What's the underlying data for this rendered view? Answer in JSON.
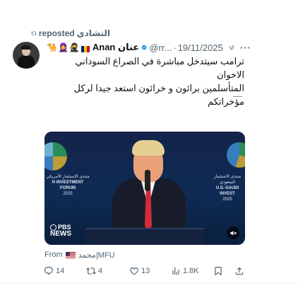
{
  "repost": {
    "user": "التشادي",
    "label": "reposted"
  },
  "author": {
    "display_name": "Anan عنان",
    "handle": "@rr...",
    "separator": "·",
    "date": "19/11/2025",
    "more": "···"
  },
  "tweet": {
    "line1": "ترامب سيتدخل مباشرة في الصراع السوداني الاخوان",
    "line2": "المتأسلمين برائون و خرائون استعد جيدا لركل مؤخراتكم",
    "line3": "__"
  },
  "media": {
    "forum_left_ar": "منتدى الاستثمار الأمريكي",
    "forum_left_en": "H INVESTMENT FORUM",
    "year_left": "2025",
    "forum_right_ar": "منتدى الاستثمار السعودي",
    "forum_right_en": "U.S.-SAUDI INVEST",
    "year_right": "2025",
    "network_top": "PBS",
    "network_bottom": "NEWS"
  },
  "source": {
    "prefix": "From",
    "name": "محمد|MFU"
  },
  "actions": {
    "replies": "14",
    "reposts": "4",
    "likes": "13",
    "views": "1.8K"
  },
  "colors": {
    "text": "#0f1419",
    "muted": "#536471",
    "verified": "#1d9bf0"
  }
}
